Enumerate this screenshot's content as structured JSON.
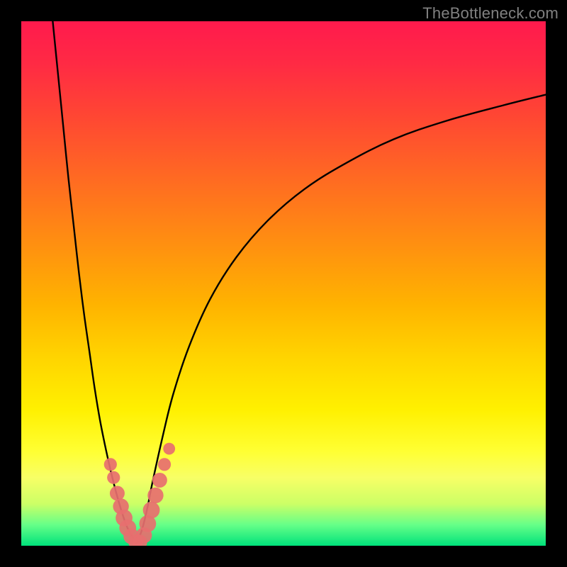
{
  "watermark": "TheBottleneck.com",
  "chart_data": {
    "type": "line",
    "title": "",
    "xlabel": "",
    "ylabel": "",
    "xlim": [
      0,
      100
    ],
    "ylim": [
      0,
      100
    ],
    "series": [
      {
        "name": "curve-left",
        "x": [
          6,
          7,
          8,
          9,
          10,
          11,
          12,
          13,
          14,
          15,
          16,
          17,
          18,
          19,
          20,
          21,
          22
        ],
        "values": [
          100,
          90,
          80,
          70,
          61,
          52,
          44,
          37,
          30,
          24,
          19,
          14.5,
          10.5,
          7,
          4,
          2,
          0.5
        ]
      },
      {
        "name": "curve-right",
        "x": [
          22,
          23,
          24,
          25,
          27,
          29,
          32,
          36,
          41,
          47,
          54,
          62,
          71,
          81,
          92,
          100
        ],
        "values": [
          0.5,
          3,
          7,
          12,
          21,
          29,
          38,
          47,
          55,
          62,
          68,
          73,
          77.5,
          81,
          84,
          86
        ]
      }
    ],
    "markers": {
      "name": "dots",
      "color": "#e76f6f",
      "points": [
        {
          "x": 17.0,
          "y": 15.5,
          "r": 1.3
        },
        {
          "x": 17.6,
          "y": 13.0,
          "r": 1.3
        },
        {
          "x": 18.3,
          "y": 10.0,
          "r": 1.5
        },
        {
          "x": 19.0,
          "y": 7.5,
          "r": 1.6
        },
        {
          "x": 19.6,
          "y": 5.3,
          "r": 1.7
        },
        {
          "x": 20.3,
          "y": 3.4,
          "r": 1.7
        },
        {
          "x": 21.0,
          "y": 1.8,
          "r": 1.6
        },
        {
          "x": 21.8,
          "y": 0.8,
          "r": 1.5
        },
        {
          "x": 22.6,
          "y": 0.7,
          "r": 1.5
        },
        {
          "x": 23.4,
          "y": 2.0,
          "r": 1.6
        },
        {
          "x": 24.1,
          "y": 4.2,
          "r": 1.7
        },
        {
          "x": 24.8,
          "y": 6.8,
          "r": 1.7
        },
        {
          "x": 25.6,
          "y": 9.6,
          "r": 1.6
        },
        {
          "x": 26.4,
          "y": 12.5,
          "r": 1.5
        },
        {
          "x": 27.3,
          "y": 15.5,
          "r": 1.3
        },
        {
          "x": 28.2,
          "y": 18.5,
          "r": 1.2
        }
      ]
    }
  }
}
